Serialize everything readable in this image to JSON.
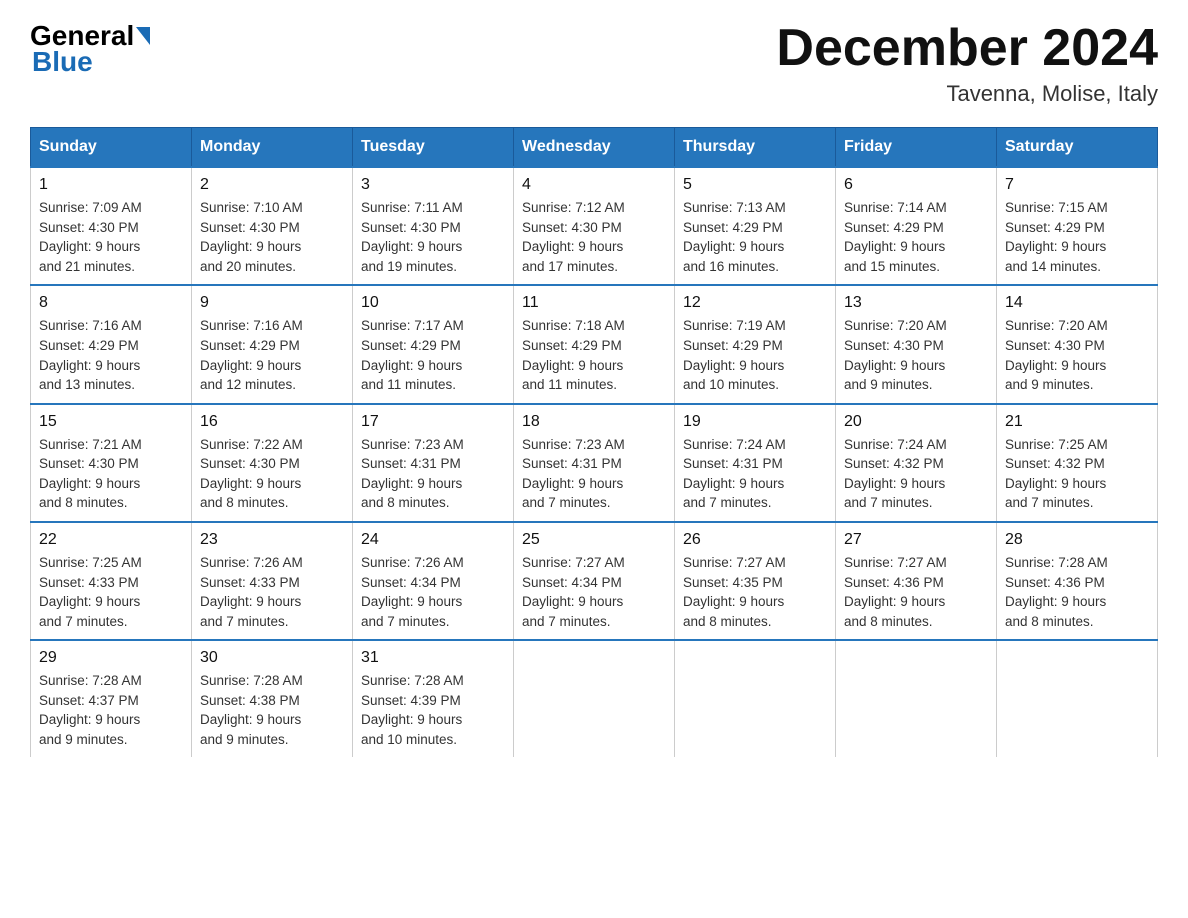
{
  "logo": {
    "general": "General",
    "blue": "Blue"
  },
  "title": "December 2024",
  "location": "Tavenna, Molise, Italy",
  "days_of_week": [
    "Sunday",
    "Monday",
    "Tuesday",
    "Wednesday",
    "Thursday",
    "Friday",
    "Saturday"
  ],
  "weeks": [
    [
      {
        "day": "1",
        "info": "Sunrise: 7:09 AM\nSunset: 4:30 PM\nDaylight: 9 hours\nand 21 minutes."
      },
      {
        "day": "2",
        "info": "Sunrise: 7:10 AM\nSunset: 4:30 PM\nDaylight: 9 hours\nand 20 minutes."
      },
      {
        "day": "3",
        "info": "Sunrise: 7:11 AM\nSunset: 4:30 PM\nDaylight: 9 hours\nand 19 minutes."
      },
      {
        "day": "4",
        "info": "Sunrise: 7:12 AM\nSunset: 4:30 PM\nDaylight: 9 hours\nand 17 minutes."
      },
      {
        "day": "5",
        "info": "Sunrise: 7:13 AM\nSunset: 4:29 PM\nDaylight: 9 hours\nand 16 minutes."
      },
      {
        "day": "6",
        "info": "Sunrise: 7:14 AM\nSunset: 4:29 PM\nDaylight: 9 hours\nand 15 minutes."
      },
      {
        "day": "7",
        "info": "Sunrise: 7:15 AM\nSunset: 4:29 PM\nDaylight: 9 hours\nand 14 minutes."
      }
    ],
    [
      {
        "day": "8",
        "info": "Sunrise: 7:16 AM\nSunset: 4:29 PM\nDaylight: 9 hours\nand 13 minutes."
      },
      {
        "day": "9",
        "info": "Sunrise: 7:16 AM\nSunset: 4:29 PM\nDaylight: 9 hours\nand 12 minutes."
      },
      {
        "day": "10",
        "info": "Sunrise: 7:17 AM\nSunset: 4:29 PM\nDaylight: 9 hours\nand 11 minutes."
      },
      {
        "day": "11",
        "info": "Sunrise: 7:18 AM\nSunset: 4:29 PM\nDaylight: 9 hours\nand 11 minutes."
      },
      {
        "day": "12",
        "info": "Sunrise: 7:19 AM\nSunset: 4:29 PM\nDaylight: 9 hours\nand 10 minutes."
      },
      {
        "day": "13",
        "info": "Sunrise: 7:20 AM\nSunset: 4:30 PM\nDaylight: 9 hours\nand 9 minutes."
      },
      {
        "day": "14",
        "info": "Sunrise: 7:20 AM\nSunset: 4:30 PM\nDaylight: 9 hours\nand 9 minutes."
      }
    ],
    [
      {
        "day": "15",
        "info": "Sunrise: 7:21 AM\nSunset: 4:30 PM\nDaylight: 9 hours\nand 8 minutes."
      },
      {
        "day": "16",
        "info": "Sunrise: 7:22 AM\nSunset: 4:30 PM\nDaylight: 9 hours\nand 8 minutes."
      },
      {
        "day": "17",
        "info": "Sunrise: 7:23 AM\nSunset: 4:31 PM\nDaylight: 9 hours\nand 8 minutes."
      },
      {
        "day": "18",
        "info": "Sunrise: 7:23 AM\nSunset: 4:31 PM\nDaylight: 9 hours\nand 7 minutes."
      },
      {
        "day": "19",
        "info": "Sunrise: 7:24 AM\nSunset: 4:31 PM\nDaylight: 9 hours\nand 7 minutes."
      },
      {
        "day": "20",
        "info": "Sunrise: 7:24 AM\nSunset: 4:32 PM\nDaylight: 9 hours\nand 7 minutes."
      },
      {
        "day": "21",
        "info": "Sunrise: 7:25 AM\nSunset: 4:32 PM\nDaylight: 9 hours\nand 7 minutes."
      }
    ],
    [
      {
        "day": "22",
        "info": "Sunrise: 7:25 AM\nSunset: 4:33 PM\nDaylight: 9 hours\nand 7 minutes."
      },
      {
        "day": "23",
        "info": "Sunrise: 7:26 AM\nSunset: 4:33 PM\nDaylight: 9 hours\nand 7 minutes."
      },
      {
        "day": "24",
        "info": "Sunrise: 7:26 AM\nSunset: 4:34 PM\nDaylight: 9 hours\nand 7 minutes."
      },
      {
        "day": "25",
        "info": "Sunrise: 7:27 AM\nSunset: 4:34 PM\nDaylight: 9 hours\nand 7 minutes."
      },
      {
        "day": "26",
        "info": "Sunrise: 7:27 AM\nSunset: 4:35 PM\nDaylight: 9 hours\nand 8 minutes."
      },
      {
        "day": "27",
        "info": "Sunrise: 7:27 AM\nSunset: 4:36 PM\nDaylight: 9 hours\nand 8 minutes."
      },
      {
        "day": "28",
        "info": "Sunrise: 7:28 AM\nSunset: 4:36 PM\nDaylight: 9 hours\nand 8 minutes."
      }
    ],
    [
      {
        "day": "29",
        "info": "Sunrise: 7:28 AM\nSunset: 4:37 PM\nDaylight: 9 hours\nand 9 minutes."
      },
      {
        "day": "30",
        "info": "Sunrise: 7:28 AM\nSunset: 4:38 PM\nDaylight: 9 hours\nand 9 minutes."
      },
      {
        "day": "31",
        "info": "Sunrise: 7:28 AM\nSunset: 4:39 PM\nDaylight: 9 hours\nand 10 minutes."
      },
      null,
      null,
      null,
      null
    ]
  ]
}
